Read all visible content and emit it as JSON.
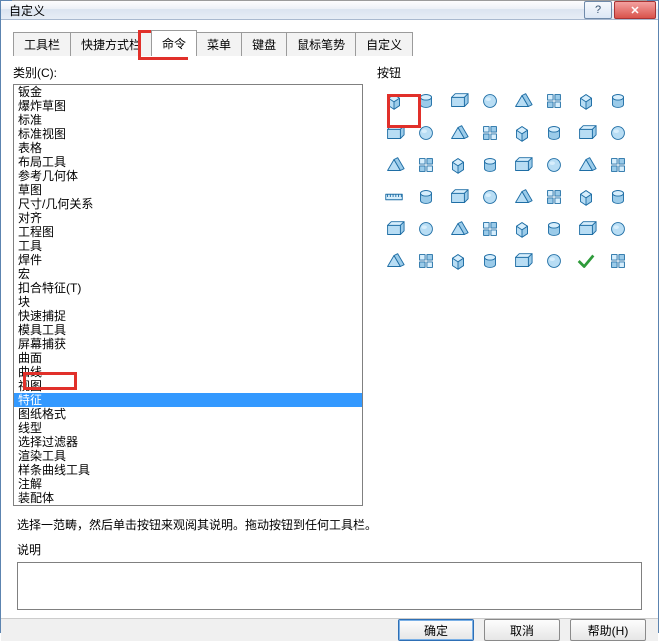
{
  "window": {
    "title": "自定义"
  },
  "tabs": [
    {
      "label": "工具栏"
    },
    {
      "label": "快捷方式栏"
    },
    {
      "label": "命令",
      "active": true
    },
    {
      "label": "菜单"
    },
    {
      "label": "键盘"
    },
    {
      "label": "鼠标笔势"
    },
    {
      "label": "自定义"
    }
  ],
  "category": {
    "label": "类别(C):",
    "items": [
      "钣金",
      "爆炸草图",
      "标准",
      "标准视图",
      "表格",
      "布局工具",
      "参考几何体",
      "草图",
      "尺寸/几何关系",
      "对齐",
      "工程图",
      "工具",
      "焊件",
      "宏",
      "扣合特征(T)",
      "块",
      "快速捕捉",
      "模具工具",
      "屏幕捕获",
      "曲面",
      "曲线",
      "视图",
      "特征",
      "图纸格式",
      "线型",
      "选择过滤器",
      "渲染工具",
      "样条曲线工具",
      "注解",
      "装配体"
    ],
    "selected_index": 22
  },
  "buttons_panel": {
    "label": "按钮",
    "icons": [
      "cube-icon",
      "swirl-icon",
      "sweep-icon",
      "arrow-down-icon",
      "box-icon",
      "shell-icon",
      "window-icon",
      "unfold-icon",
      "pyramid-icon",
      "wedge-icon",
      "box2-icon",
      "block-icon",
      "cylinder-icon",
      "light-icon",
      "plane-icon",
      "cube2-icon",
      "sphere-icon",
      "hemisphere-icon",
      "prism-icon",
      "box3-icon",
      "splitbox-icon",
      "film-icon",
      "box4-icon",
      "box5-icon",
      "ruler-icon",
      "cubewire-icon",
      "box6-icon",
      "corner-icon",
      "corner2-icon",
      "x-icon",
      "mirror-icon",
      "pattern-icon",
      "tree-icon",
      "grid-icon",
      "grid2-icon",
      "stairs-icon",
      "cubes-icon",
      "cubes2-icon",
      "cubes3-icon",
      "axes-icon",
      "cube3-icon",
      "path-icon",
      "diamond-icon",
      "layers-icon",
      "cubes4-icon",
      "pattern2-icon",
      "check-icon",
      "grid-3d-icon"
    ]
  },
  "hint": "选择一范畴，然后单击按钮来观阅其说明。拖动按钮到任何工具栏。",
  "desc_label": "说明",
  "footer": {
    "ok": "确定",
    "cancel": "取消",
    "help": "帮助(H)"
  }
}
